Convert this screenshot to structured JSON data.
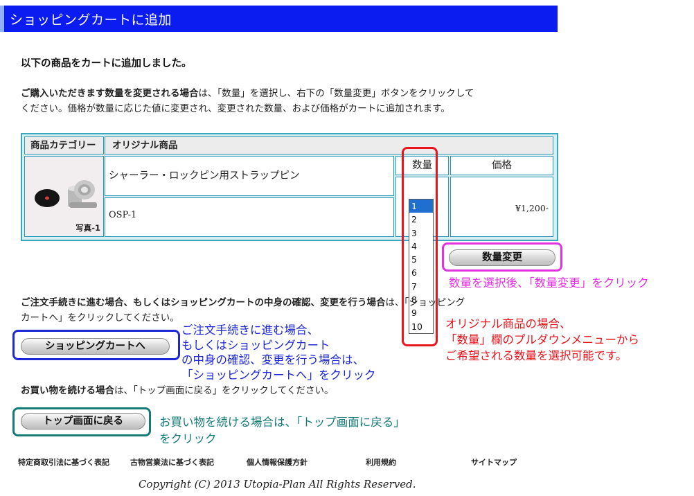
{
  "header": {
    "title": "ショッピングカートに追加"
  },
  "lead": "以下の商品をカートに追加しました。",
  "instructions": {
    "bold_part": "ご購入いただきます数量を変更される場合",
    "line1_rest": "は、「数量」を選択し、右下の「数量変更」ボタンをクリックして",
    "line2": "ください。価格が数量に応じた値に変更され、変更された数量、および価格がカートに追加されます。"
  },
  "cart": {
    "category_header": "商品カテゴリー",
    "category_value": "オリジナル商品",
    "product_name": "シャーラー・ロックピン用ストラップピン",
    "product_code": "OSP-1",
    "photo_label": "写真-1",
    "qty_header": "数量",
    "price_header": "価格",
    "price": "¥1,200-",
    "qty_options": [
      "1",
      "2",
      "3",
      "4",
      "5",
      "6",
      "7",
      "8",
      "9",
      "10"
    ],
    "qty_selected": "1"
  },
  "buttons": {
    "update_qty": "数量変更",
    "to_cart": "ショッピングカートへ",
    "to_top": "トップ画面に戻る"
  },
  "proceed": {
    "bold_part": "ご注文手続きに進む場合、もしくはショッピングカートの中身の確認、変更を行う場合",
    "rest": "は、「ショッピング",
    "line2": "カートへ」をクリックしてください。"
  },
  "continue_shopping": {
    "bold_part": "お買い物を続ける場合",
    "rest": "は、「トップ画面に戻る」をクリックしてください。"
  },
  "annotations": {
    "magenta": "数量を選択後、「数量変更」をクリック",
    "red_line1": "オリジナル商品の場合、",
    "red_line2": "「数量」欄のプルダウンメニューから",
    "red_line3": "ご希望される数量を選択可能です。",
    "blue_line1": "ご注文手続きに進む場合、",
    "blue_line2": "もしくはショッピングカート",
    "blue_line3": "の中身の確認、変更を行う場合は、",
    "blue_line4": "「ショッピングカートへ」をクリック",
    "teal_line1": "お買い物を続ける場合は、「トップ画面に戻る」",
    "teal_line2": "をクリック"
  },
  "footer": {
    "links": [
      "特定商取引法に基づく表記",
      "古物営業法に基づく表記",
      "個人情報保護方針",
      "利用規約",
      "サイトマップ"
    ],
    "copyright": "Copyright (C) 2013 Utopia-Plan All Rights Reserved."
  },
  "colors": {
    "header_bg": "#0a1cf0",
    "annotation_red": "#e8141e",
    "annotation_magenta": "#e232e2",
    "annotation_blue": "#1d27d4",
    "annotation_teal": "#147a78",
    "table_border": "#2a98b4"
  }
}
